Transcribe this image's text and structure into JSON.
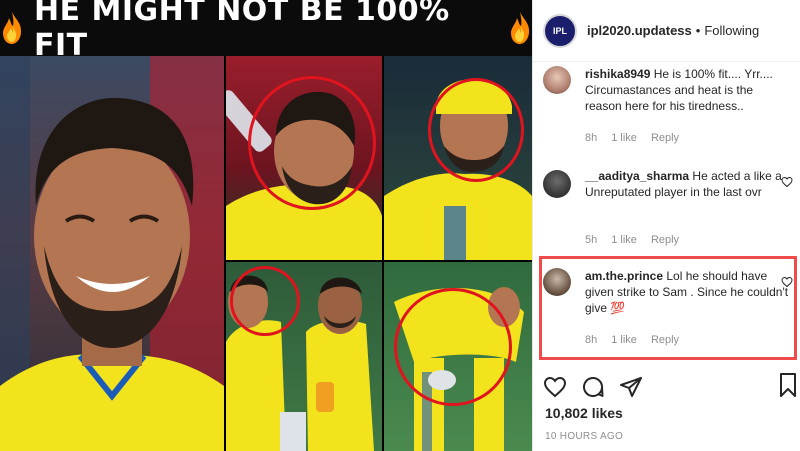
{
  "meme": {
    "title": "HE MIGHT NOT BE 100% FIT",
    "fire_icon": "fire-emoji",
    "ring_color": "#e0141e"
  },
  "post": {
    "account": "ipl2020.updatess",
    "avatar_text": "IPL",
    "separator": "•",
    "follow_status": "Following"
  },
  "comments": [
    {
      "user": "rishika8949",
      "text": "He is 100% fit.... Yrr.... Circumastances and heat is the reason here for his tiredness..",
      "time": "8h",
      "likes": "1 like",
      "reply": "Reply"
    },
    {
      "user": "__aaditya_sharma",
      "text": "He acted a like a Unreputated player in the last ovr",
      "time": "5h",
      "likes": "1 like",
      "reply": "Reply"
    },
    {
      "user": "am.the.prince",
      "text": "Lol he should have given strike to Sam . Since he couldn't give",
      "emoji": "💯",
      "time": "8h",
      "likes": "1 like",
      "reply": "Reply"
    }
  ],
  "likes_count": "10,802 likes",
  "timestamp": "10 HOURS AGO",
  "highlight_color": "#ef4b4b"
}
